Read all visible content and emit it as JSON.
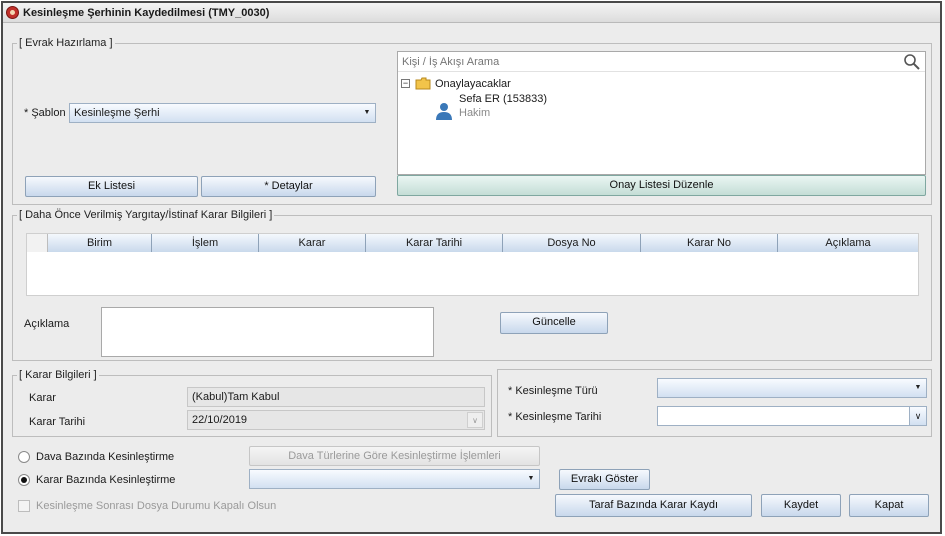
{
  "window": {
    "title": "Kesinleşme Şerhinin Kaydedilmesi (TMY_0030)"
  },
  "evrak": {
    "legend": "[ Evrak Hazırlama ]",
    "sablon_label": "* Şablon",
    "sablon_value": "Kesinleşme Şerhi",
    "ek_listesi": "Ek Listesi",
    "detaylar": "* Detaylar",
    "search_placeholder": "Kişi / İş Akışı Arama",
    "tree_root": "Onaylayacaklar",
    "tree_person_name": "Sefa ER (153833)",
    "tree_person_role": "Hakim",
    "onay_listesi": "Onay Listesi Düzenle"
  },
  "gecmis": {
    "legend": "[ Daha Önce Verilmiş Yargıtay/İstinaf Karar Bilgileri ]",
    "columns": [
      "Birim",
      "İşlem",
      "Karar",
      "Karar Tarihi",
      "Dosya No",
      "Karar No",
      "Açıklama"
    ],
    "aciklama_label": "Açıklama",
    "guncelle": "Güncelle"
  },
  "karar": {
    "legend": "[ Karar Bilgileri ]",
    "karar_label": "Karar",
    "karar_value": "(Kabul)Tam Kabul",
    "tarih_label": "Karar Tarihi",
    "tarih_value": "22/10/2019"
  },
  "kesinlesme": {
    "turu_label": "* Kesinleşme Türü",
    "turu_value": "",
    "tarihi_label": "* Kesinleşme Tarihi",
    "tarihi_value": ""
  },
  "options": {
    "dava_bazinda": "Dava Bazında Kesinleştirme",
    "karar_bazinda": "Karar Bazında Kesinleştirme",
    "dava_turleri_button": "Dava Türlerine Göre Kesinleştirme İşlemleri",
    "karar_combo_value": "",
    "evrak_goster": "Evrakı Göster",
    "kapali_olsun": "Kesinleşme Sonrası Dosya Durumu Kapalı Olsun",
    "selected": "karar_bazinda"
  },
  "actions": {
    "taraf_bazinda": "Taraf Bazında Karar Kaydı",
    "kaydet": "Kaydet",
    "kapat": "Kapat"
  }
}
